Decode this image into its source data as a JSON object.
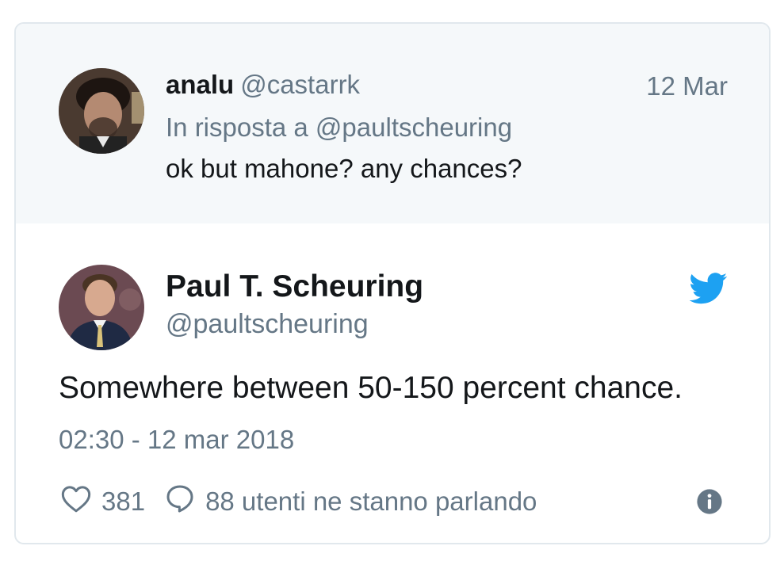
{
  "parent_tweet": {
    "display_name": "analu",
    "handle": "@castarrk",
    "date": "12 Mar",
    "replying_to": "In risposta a @paultscheuring",
    "text": "ok but mahone? any chances?"
  },
  "main_tweet": {
    "display_name": "Paul T. Scheuring",
    "handle": "@paultscheuring",
    "text": "Somewhere between 50-150 percent chance.",
    "timestamp": "02:30 - 12 mar 2018",
    "like_count": "381",
    "reply_summary": "88 utenti ne stanno parlando"
  },
  "icons": {
    "brand": "twitter-bird-icon",
    "like": "heart-icon",
    "reply": "speech-bubble-icon",
    "info": "info-icon"
  },
  "colors": {
    "twitter_blue": "#1da1f2",
    "secondary_text": "#657786",
    "primary_text": "#14171a",
    "parent_background": "#f5f8fa",
    "border": "#e1e8ed"
  }
}
